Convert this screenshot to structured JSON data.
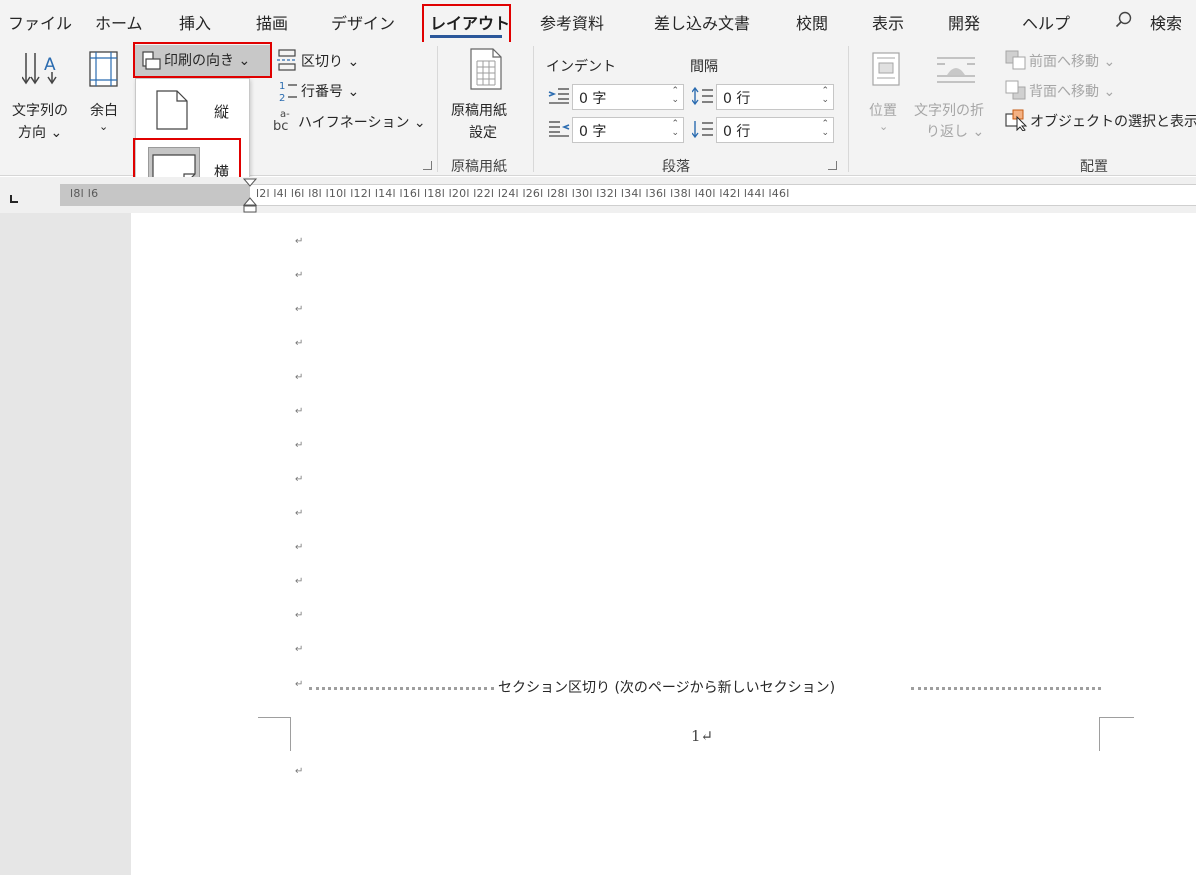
{
  "tabs": [
    "ファイル",
    "ホーム",
    "挿入",
    "描画",
    "デザイン",
    "レイアウト",
    "参考資料",
    "差し込み文書",
    "校閲",
    "表示",
    "開発",
    "ヘルプ"
  ],
  "active_tab": "レイアウト",
  "search": {
    "label": "検索"
  },
  "page_setup": {
    "text_direction": [
      "文字列の",
      "方向 ⌄"
    ],
    "margins": [
      "余白",
      "⌄"
    ],
    "orientation_button": "印刷の向き ⌄",
    "breaks": "区切り ⌄",
    "line_numbers": "行番号 ⌄",
    "hyphenation": "ハイフネーション ⌄"
  },
  "orientation_menu": {
    "items": [
      {
        "label": "縦",
        "selected": false
      },
      {
        "label": "横",
        "selected": true
      }
    ]
  },
  "manuscript": {
    "button": [
      "原稿用紙",
      "設定"
    ],
    "group_label": "原稿用紙"
  },
  "paragraph": {
    "indent_label": "インデント",
    "spacing_label": "間隔",
    "indent_left": "0 字",
    "indent_right": "0 字",
    "spacing_before": "0 行",
    "spacing_after": "0 行",
    "group_label": "段落"
  },
  "arrange": {
    "position": [
      "位置",
      "⌄"
    ],
    "wrap_text": [
      "文字列の折",
      "り返し ⌄"
    ],
    "bring_forward": "前面へ移動 ⌄",
    "send_backward": "背面へ移動 ⌄",
    "selection_pane": "オブジェクトの選択と表示",
    "group_label": "配置"
  },
  "ruler": {
    "left_numbers": "l8l  l6",
    "numbers": "l2l  l4l  l6l  l8l  l10l  l12l  l14l  l16l  l18l  l20l  l22l  l24l  l26l  l28l  l30l  l32l  l34l  l36l  l38l  l40l  l42l  l44l  l46l"
  },
  "document": {
    "paragraph_mark": "↵",
    "section_break": "セクション区切り (次のページから新しいセクション)",
    "page_number": "1↵"
  },
  "colors": {
    "accent": "#2b579a",
    "highlight": "#e00000",
    "ribbon_bg": "#f3f3f3"
  }
}
